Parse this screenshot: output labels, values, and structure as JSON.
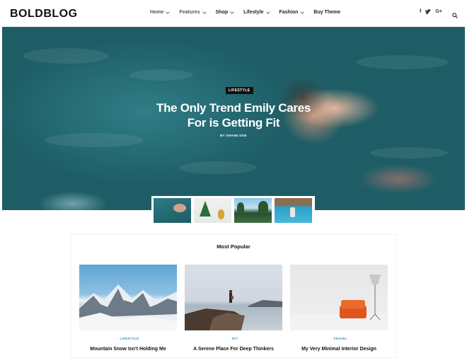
{
  "header": {
    "logo": "BOLDBLOG",
    "nav": [
      {
        "label": "Home",
        "has_dropdown": true
      },
      {
        "label": "Features",
        "has_dropdown": true
      },
      {
        "label": "Shop",
        "has_dropdown": true
      },
      {
        "label": "Lifestyle",
        "has_dropdown": true
      },
      {
        "label": "Fashion",
        "has_dropdown": true
      },
      {
        "label": "Buy Theme",
        "has_dropdown": false
      }
    ],
    "social": {
      "facebook": "f",
      "twitter": "t",
      "google": "G+"
    },
    "search_icon": "search-icon"
  },
  "hero": {
    "category": "LIFESTYLE",
    "title_line1": "The Only Trend Emily Cares",
    "title_line2": "For is Getting Fit",
    "author": "BY SHANE DOE"
  },
  "thumbnails": [
    {
      "subject": "woman floating in pool"
    },
    {
      "subject": "plant and pineapple"
    },
    {
      "subject": "tropical beach palms"
    },
    {
      "subject": "person at swimming pool"
    }
  ],
  "popular": {
    "title": "Most Popular",
    "cards": [
      {
        "category": "LIFESTYLE",
        "title": "Mountain Snow Isn't Holding Me"
      },
      {
        "category": "DIY",
        "title": "A Serene Place For Deep Thinkers"
      },
      {
        "category": "TRAVEL",
        "title": "My Very Minimal Interior Design"
      }
    ]
  },
  "colors": {
    "accent": "#2a8fb5",
    "badge_bg": "#111111",
    "text": "#111111"
  }
}
